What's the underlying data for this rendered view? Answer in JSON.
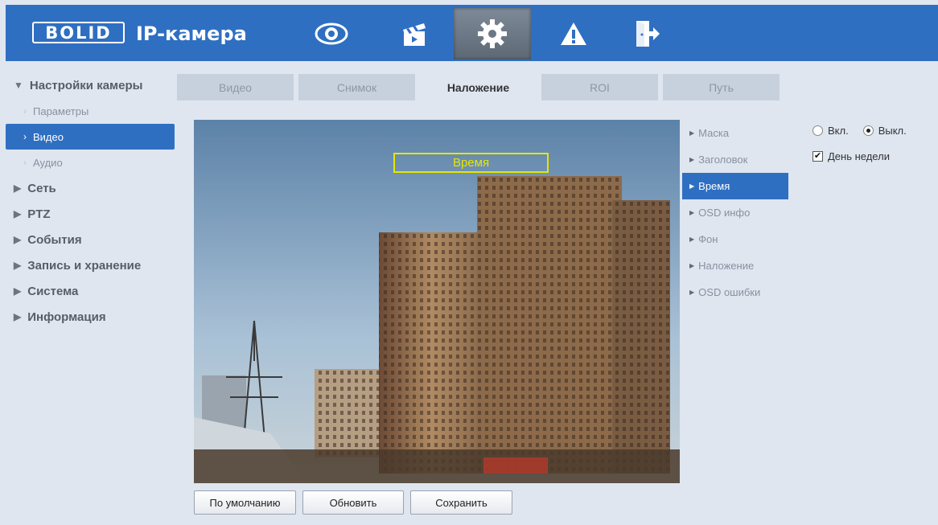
{
  "header": {
    "logo_text": "BOLID",
    "title": "IP-камера",
    "nav": [
      {
        "name": "live-view",
        "icon": "eye-icon"
      },
      {
        "name": "playback",
        "icon": "clapperboard-icon"
      },
      {
        "name": "setup",
        "icon": "gear-icon"
      },
      {
        "name": "alarm",
        "icon": "warning-icon"
      },
      {
        "name": "logout",
        "icon": "logout-icon"
      }
    ],
    "brand_color": "#2f6fc2"
  },
  "sidebar": {
    "camera_settings": "Настройки камеры",
    "subitems": [
      "Параметры",
      "Видео",
      "Аудио"
    ],
    "categories": [
      "Сеть",
      "PTZ",
      "События",
      "Запись и хранение",
      "Система",
      "Информация"
    ]
  },
  "tabs": [
    "Видео",
    "Снимок",
    "Наложение",
    "ROI",
    "Путь"
  ],
  "active_tab": "Наложение",
  "video": {
    "osd_label": "Время"
  },
  "osd_menu": [
    "Маска",
    "Заголовок",
    "Время",
    "OSD инфо",
    "Фон",
    "Наложение",
    "OSD ошибки"
  ],
  "osd_menu_active": "Время",
  "options": {
    "on_label": "Вкл.",
    "off_label": "Выкл.",
    "selected": "off",
    "weekday_label": "День недели",
    "weekday_checked": true
  },
  "buttons": {
    "default": "По умолчанию",
    "refresh": "Обновить",
    "save": "Сохранить"
  }
}
